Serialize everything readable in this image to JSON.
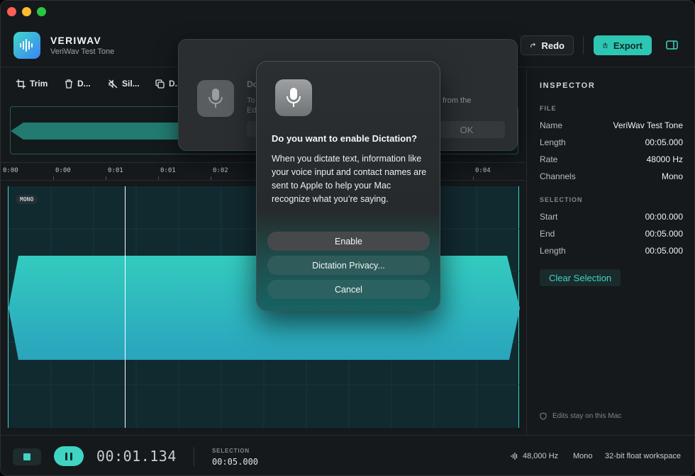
{
  "app": {
    "title": "VERIWAV",
    "subtitle": "VeriWav Test Tone"
  },
  "header": {
    "redo_label": "Redo",
    "export_label": "Export"
  },
  "toolbar": {
    "trim": "Trim",
    "delete": "D...",
    "silence": "Sil...",
    "duplicate": "D..."
  },
  "ruler": {
    "ticks": [
      "0:00",
      "0:00",
      "0:01",
      "0:01",
      "0:02",
      "0:04"
    ]
  },
  "waveform": {
    "channel_badge": "MONO"
  },
  "inspector": {
    "title": "INSPECTOR",
    "file_section": "FILE",
    "file_rows": [
      {
        "k": "Name",
        "v": "VeriWav Test Tone"
      },
      {
        "k": "Length",
        "v": "00:05.000"
      },
      {
        "k": "Rate",
        "v": "48000 Hz"
      },
      {
        "k": "Channels",
        "v": "Mono"
      }
    ],
    "selection_section": "SELECTION",
    "selection_rows": [
      {
        "k": "Start",
        "v": "00:00.000"
      },
      {
        "k": "End",
        "v": "00:05.000"
      },
      {
        "k": "Length",
        "v": "00:05.000"
      }
    ],
    "clear_selection": "Clear Selection",
    "footer": "Edits stay on this Mac"
  },
  "transport": {
    "timecode": "00:01.134",
    "selection_label": "SELECTION",
    "selection_value": "00:05.000",
    "sample_rate": "48,000 Hz",
    "channels": "Mono",
    "workspace": "32-bit float workspace"
  },
  "bg_dialog": {
    "title": "Do",
    "line1": "To",
    "line2": "Ed",
    "line3": "from the",
    "ok": "OK"
  },
  "dialog": {
    "title": "Do you want to enable Dictation?",
    "body": "When you dictate text, information like your voice input and contact names are sent to Apple to help your Mac recognize what you’re saying.",
    "enable": "Enable",
    "privacy": "Dictation Privacy...",
    "cancel": "Cancel"
  },
  "colors": {
    "accent": "#3fd5c2",
    "wave_top": "#33cbbf",
    "wave_bottom": "#2aa4bd"
  }
}
